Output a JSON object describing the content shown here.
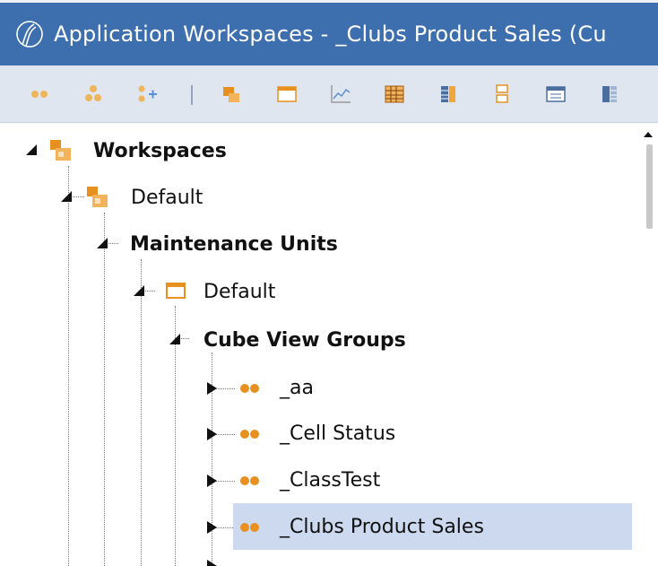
{
  "window": {
    "title": "Application Workspaces - _Clubs Product Sales (Cu"
  },
  "toolbar": {
    "icons": [
      "dots-icon",
      "cluster-icon",
      "add-dots-icon",
      "separator",
      "workspace-folder-icon",
      "calendar-icon",
      "line-chart-icon",
      "grid-icon",
      "table-columns-icon",
      "list-icon",
      "window-icon",
      "column-split-icon"
    ]
  },
  "tree": {
    "workspaces": "Workspaces",
    "default_workspace": "Default",
    "maintenance_units": "Maintenance Units",
    "default_unit": "Default",
    "cube_view_groups": "Cube View Groups",
    "groups": [
      {
        "label": "_aa"
      },
      {
        "label": "_Cell Status"
      },
      {
        "label": "_ClassTest"
      },
      {
        "label": "_Clubs Product Sales",
        "selected": true
      }
    ]
  },
  "colors": {
    "titlebar": "#3d6fae",
    "toolbar": "#dfe6f0",
    "orange": "#e8901f",
    "selection": "#cdd9ef"
  }
}
